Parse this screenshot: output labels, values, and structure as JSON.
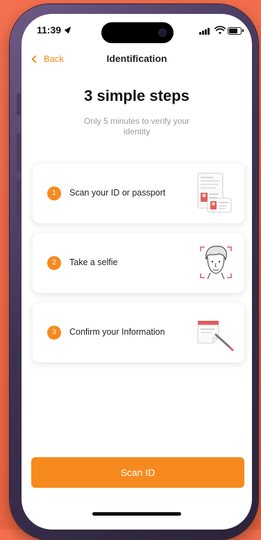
{
  "status_bar": {
    "time": "11:39"
  },
  "nav": {
    "back_label": "Back",
    "title": "Identification"
  },
  "heading": "3 simple steps",
  "subheading": "Only 5 minutes to verify your identity",
  "steps": [
    {
      "number": "1",
      "label": "Scan your ID or passport",
      "icon": "id-documents-icon"
    },
    {
      "number": "2",
      "label": "Take a selfie",
      "icon": "selfie-face-icon"
    },
    {
      "number": "3",
      "label": "Confirm your Information",
      "icon": "confirm-document-icon"
    }
  ],
  "cta": {
    "label": "Scan ID"
  },
  "colors": {
    "accent": "#f68a1f",
    "background": "#f36f4f",
    "frame": "#3d3252",
    "illustration_red": "#e25c5c"
  }
}
